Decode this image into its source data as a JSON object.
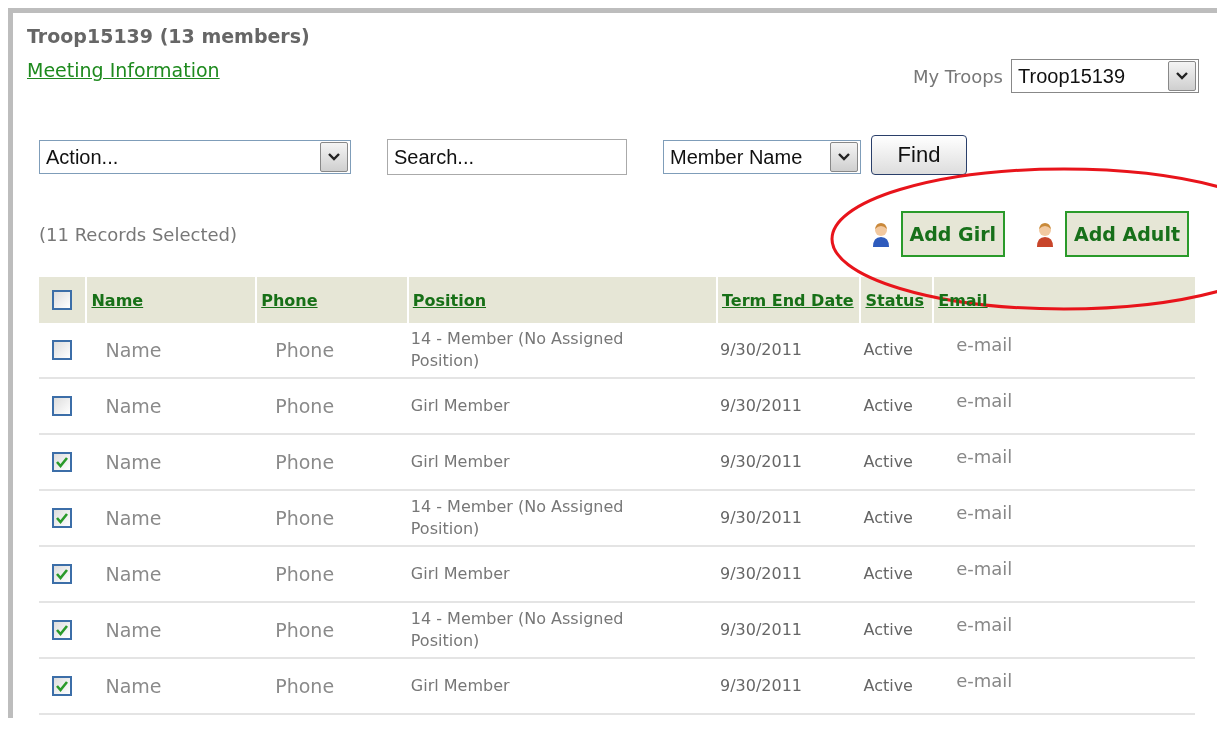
{
  "title": "Troop15139 (13 members)",
  "meeting_link": "Meeting Information",
  "troop_picker": {
    "label": "My Troops",
    "value": "Troop15139"
  },
  "toolbar": {
    "action": {
      "value": "Action..."
    },
    "search": {
      "placeholder": "Search..."
    },
    "search_by": {
      "value": "Member Name"
    },
    "find_button": "Find"
  },
  "selection_count": "(11 Records Selected)",
  "add_buttons": [
    {
      "label": "Add Girl",
      "kind": "girl"
    },
    {
      "label": "Add Adult",
      "kind": "adult"
    }
  ],
  "annotation": {
    "kind": "ellipse",
    "color": "#e8141b"
  },
  "table": {
    "select_all": {
      "checked": false
    },
    "columns": [
      "Name",
      "Phone",
      "Position",
      "Term End Date",
      "Status",
      "Email"
    ],
    "rows": [
      {
        "checked": false,
        "cells": [
          "Name",
          "Phone",
          "14 - Member (No Assigned Position)",
          "9/30/2011",
          "Active",
          "e-mail"
        ]
      },
      {
        "checked": false,
        "cells": [
          "Name",
          "Phone",
          "Girl Member",
          "9/30/2011",
          "Active",
          "e-mail"
        ]
      },
      {
        "checked": true,
        "cells": [
          "Name",
          "Phone",
          "Girl Member",
          "9/30/2011",
          "Active",
          "e-mail"
        ]
      },
      {
        "checked": true,
        "cells": [
          "Name",
          "Phone",
          "14 - Member (No Assigned Position)",
          "9/30/2011",
          "Active",
          "e-mail"
        ]
      },
      {
        "checked": true,
        "cells": [
          "Name",
          "Phone",
          "Girl Member",
          "9/30/2011",
          "Active",
          "e-mail"
        ]
      },
      {
        "checked": true,
        "cells": [
          "Name",
          "Phone",
          "14 - Member (No Assigned Position)",
          "9/30/2011",
          "Active",
          "e-mail"
        ]
      },
      {
        "checked": true,
        "cells": [
          "Name",
          "Phone",
          "Girl Member",
          "9/30/2011",
          "Active",
          "e-mail"
        ]
      }
    ]
  }
}
